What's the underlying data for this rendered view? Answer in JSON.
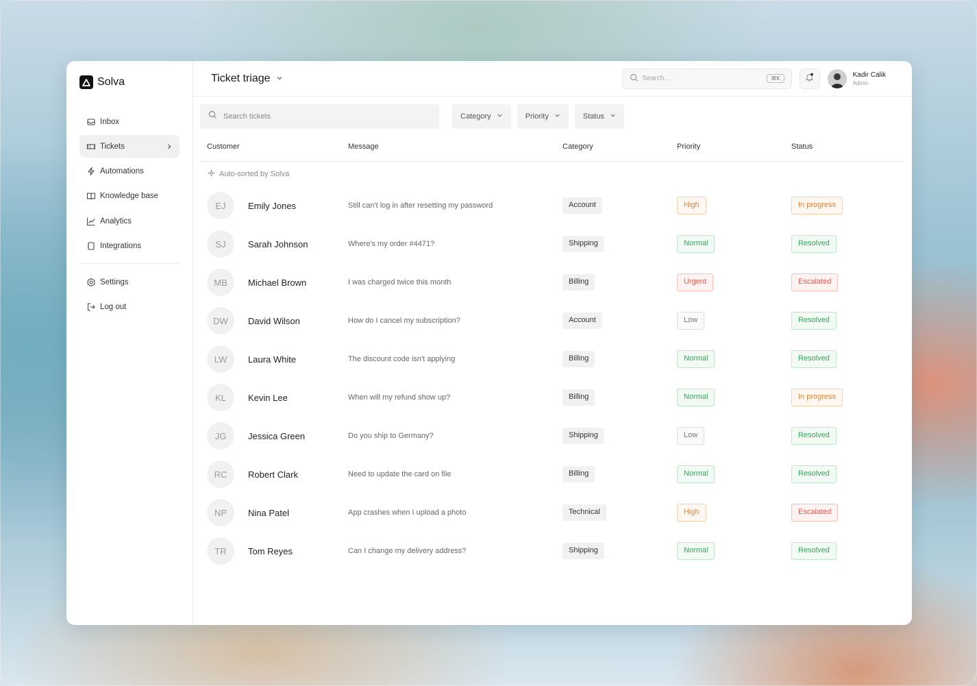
{
  "brand": {
    "name": "Solva"
  },
  "sidebar": {
    "items": [
      {
        "label": "Inbox",
        "icon": "inbox-icon",
        "name": "sidebar-item-inbox",
        "active": false
      },
      {
        "label": "Tickets",
        "icon": "ticket-icon",
        "name": "sidebar-item-tickets",
        "active": true
      },
      {
        "label": "Automations",
        "icon": "lightning-icon",
        "name": "sidebar-item-automations",
        "active": false
      },
      {
        "label": "Knowledge base",
        "icon": "book-icon",
        "name": "sidebar-item-knowledge-base",
        "active": false
      },
      {
        "label": "Analytics",
        "icon": "chart-icon",
        "name": "sidebar-item-analytics",
        "active": false
      },
      {
        "label": "Integrations",
        "icon": "integrations-icon",
        "name": "sidebar-item-integrations",
        "active": false
      }
    ],
    "bottom_items": [
      {
        "label": "Settings",
        "icon": "gear-icon",
        "name": "sidebar-item-settings"
      },
      {
        "label": "Log out",
        "icon": "logout-icon",
        "name": "sidebar-item-logout"
      }
    ]
  },
  "header": {
    "title": "Ticket triage",
    "search_placeholder": "Search...",
    "search_shortcut": "⌘K",
    "user": {
      "name": "Kadir Calik",
      "role": "Admin"
    }
  },
  "filters": {
    "search_placeholder": "Search tickets",
    "category_label": "Category",
    "priority_label": "Priority",
    "status_label": "Status"
  },
  "table": {
    "columns": {
      "customer": "Customer",
      "message": "Message",
      "category": "Category",
      "priority": "Priority",
      "status": "Status"
    },
    "auto_sort_label": "Auto-sorted by Solva",
    "rows": [
      {
        "initials": "EJ",
        "name": "Emily Jones",
        "message": "Still can't log in after resetting my password",
        "category": "Account",
        "priority": "High",
        "priority_kind": "high",
        "status": "In progress",
        "status_kind": "progress"
      },
      {
        "initials": "SJ",
        "name": "Sarah Johnson",
        "message": "Where's my order #4471?",
        "category": "Shipping",
        "priority": "Normal",
        "priority_kind": "normal",
        "status": "Resolved",
        "status_kind": "resolved"
      },
      {
        "initials": "MB",
        "name": "Michael Brown",
        "message": "I was charged twice this month",
        "category": "Billing",
        "priority": "Urgent",
        "priority_kind": "urgent",
        "status": "Escalated",
        "status_kind": "escalated"
      },
      {
        "initials": "DW",
        "name": "David Wilson",
        "message": "How do I cancel my subscription?",
        "category": "Account",
        "priority": "Low",
        "priority_kind": "low",
        "status": "Resolved",
        "status_kind": "resolved"
      },
      {
        "initials": "LW",
        "name": "Laura White",
        "message": "The discount code isn't applying",
        "category": "Billing",
        "priority": "Normal",
        "priority_kind": "normal",
        "status": "Resolved",
        "status_kind": "resolved"
      },
      {
        "initials": "KL",
        "name": "Kevin Lee",
        "message": "When will my refund show up?",
        "category": "Billing",
        "priority": "Normal",
        "priority_kind": "normal",
        "status": "In progress",
        "status_kind": "progress"
      },
      {
        "initials": "JG",
        "name": "Jessica Green",
        "message": "Do you ship to Germany?",
        "category": "Shipping",
        "priority": "Low",
        "priority_kind": "low",
        "status": "Resolved",
        "status_kind": "resolved"
      },
      {
        "initials": "RC",
        "name": "Robert Clark",
        "message": "Need to update the card on file",
        "category": "Billing",
        "priority": "Normal",
        "priority_kind": "normal",
        "status": "Resolved",
        "status_kind": "resolved"
      },
      {
        "initials": "NP",
        "name": "Nina Patel",
        "message": "App crashes when I upload a photo",
        "category": "Technical",
        "priority": "High",
        "priority_kind": "high",
        "status": "Escalated",
        "status_kind": "escalated"
      },
      {
        "initials": "TR",
        "name": "Tom Reyes",
        "message": "Can I change my delivery address?",
        "category": "Shipping",
        "priority": "Normal",
        "priority_kind": "normal",
        "status": "Resolved",
        "status_kind": "resolved"
      }
    ]
  },
  "colors": {
    "high": "#e0843a",
    "normal": "#3aa45f",
    "urgent": "#e05a4e",
    "low": "#777777"
  }
}
